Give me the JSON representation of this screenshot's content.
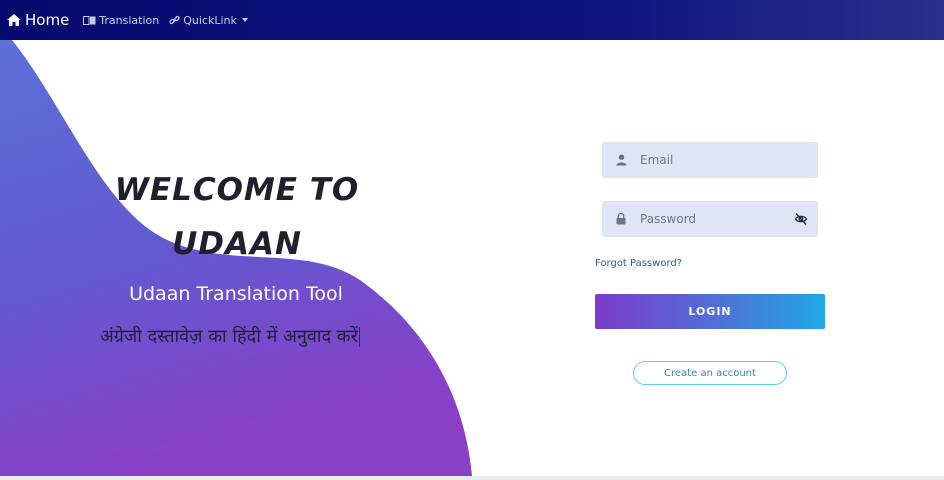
{
  "navbar": {
    "home_label": "Home",
    "home_icon": "home-icon",
    "translation_label": "Translation",
    "translation_icon": "language-icon",
    "quicklink_label": "QuickLink",
    "quicklink_icon": "link-icon"
  },
  "hero": {
    "welcome_line1": "WELCOME TO",
    "welcome_line2": "UDAAN",
    "subtitle": "Udaan Translation Tool",
    "hindi_text": "अंग्रेजी दस्तावेज़ का हिंदी में अनुवाद करें"
  },
  "login": {
    "email_placeholder": "Email",
    "email_value": "",
    "password_placeholder": "Password",
    "password_value": "",
    "forgot_label": "Forgot Password?",
    "login_label": "LOGIN",
    "create_label": "Create an account"
  },
  "colors": {
    "nav_bg": "#0c127a",
    "wave_top": "#5b6dd6",
    "wave_bottom": "#8a3fc7",
    "field_bg": "#e0e5f6",
    "button_start": "#7b3cc9",
    "button_end": "#1fa7e6"
  }
}
